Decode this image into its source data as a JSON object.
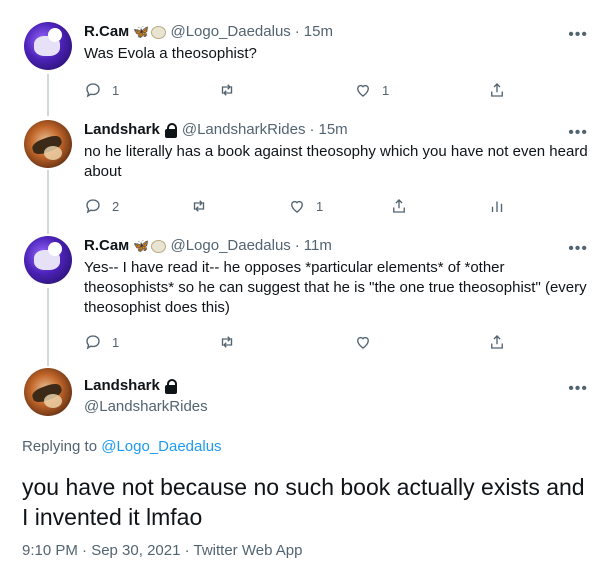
{
  "tweets": [
    {
      "name": "R.Cам",
      "handle": "@Logo_Daedalus",
      "time": "15m",
      "text": "Was Evola a theosophist?",
      "reply_count": "1",
      "retweet_count": "",
      "like_count": "1"
    },
    {
      "name": "Landshark",
      "handle": "@LandsharkRides",
      "time": "15m",
      "text": "no he literally has a book against theosophy which you have not even heard about",
      "reply_count": "2",
      "retweet_count": "",
      "like_count": "1"
    },
    {
      "name": "R.Cам",
      "handle": "@Logo_Daedalus",
      "time": "11m",
      "text": "Yes-- I have read it-- he opposes *particular elements* of *other theosophists* so he can suggest that he is \"the one true theosophist\" (every theosophist does this)",
      "reply_count": "1",
      "retweet_count": "",
      "like_count": ""
    }
  ],
  "main_tweet": {
    "name": "Landshark",
    "handle": "@LandsharkRides",
    "replying_prefix": "Replying to",
    "replying_to": "@Logo_Daedalus",
    "text": "you have not because no such book actually exists and I invented it lmfao",
    "timestamp": "9:10 PM · Sep 30, 2021 · Twitter Web App"
  },
  "separator": "·",
  "more_label": "•••",
  "colors": {
    "text": "#0f1419",
    "muted": "#536471",
    "link": "#1d9bf0",
    "thread_line": "#cfd9de"
  },
  "icons": [
    "reply-icon",
    "retweet-icon",
    "like-icon",
    "share-icon",
    "analytics-icon",
    "lock-icon",
    "more-icon",
    "butterfly-emoji",
    "sheep-emoji"
  ]
}
